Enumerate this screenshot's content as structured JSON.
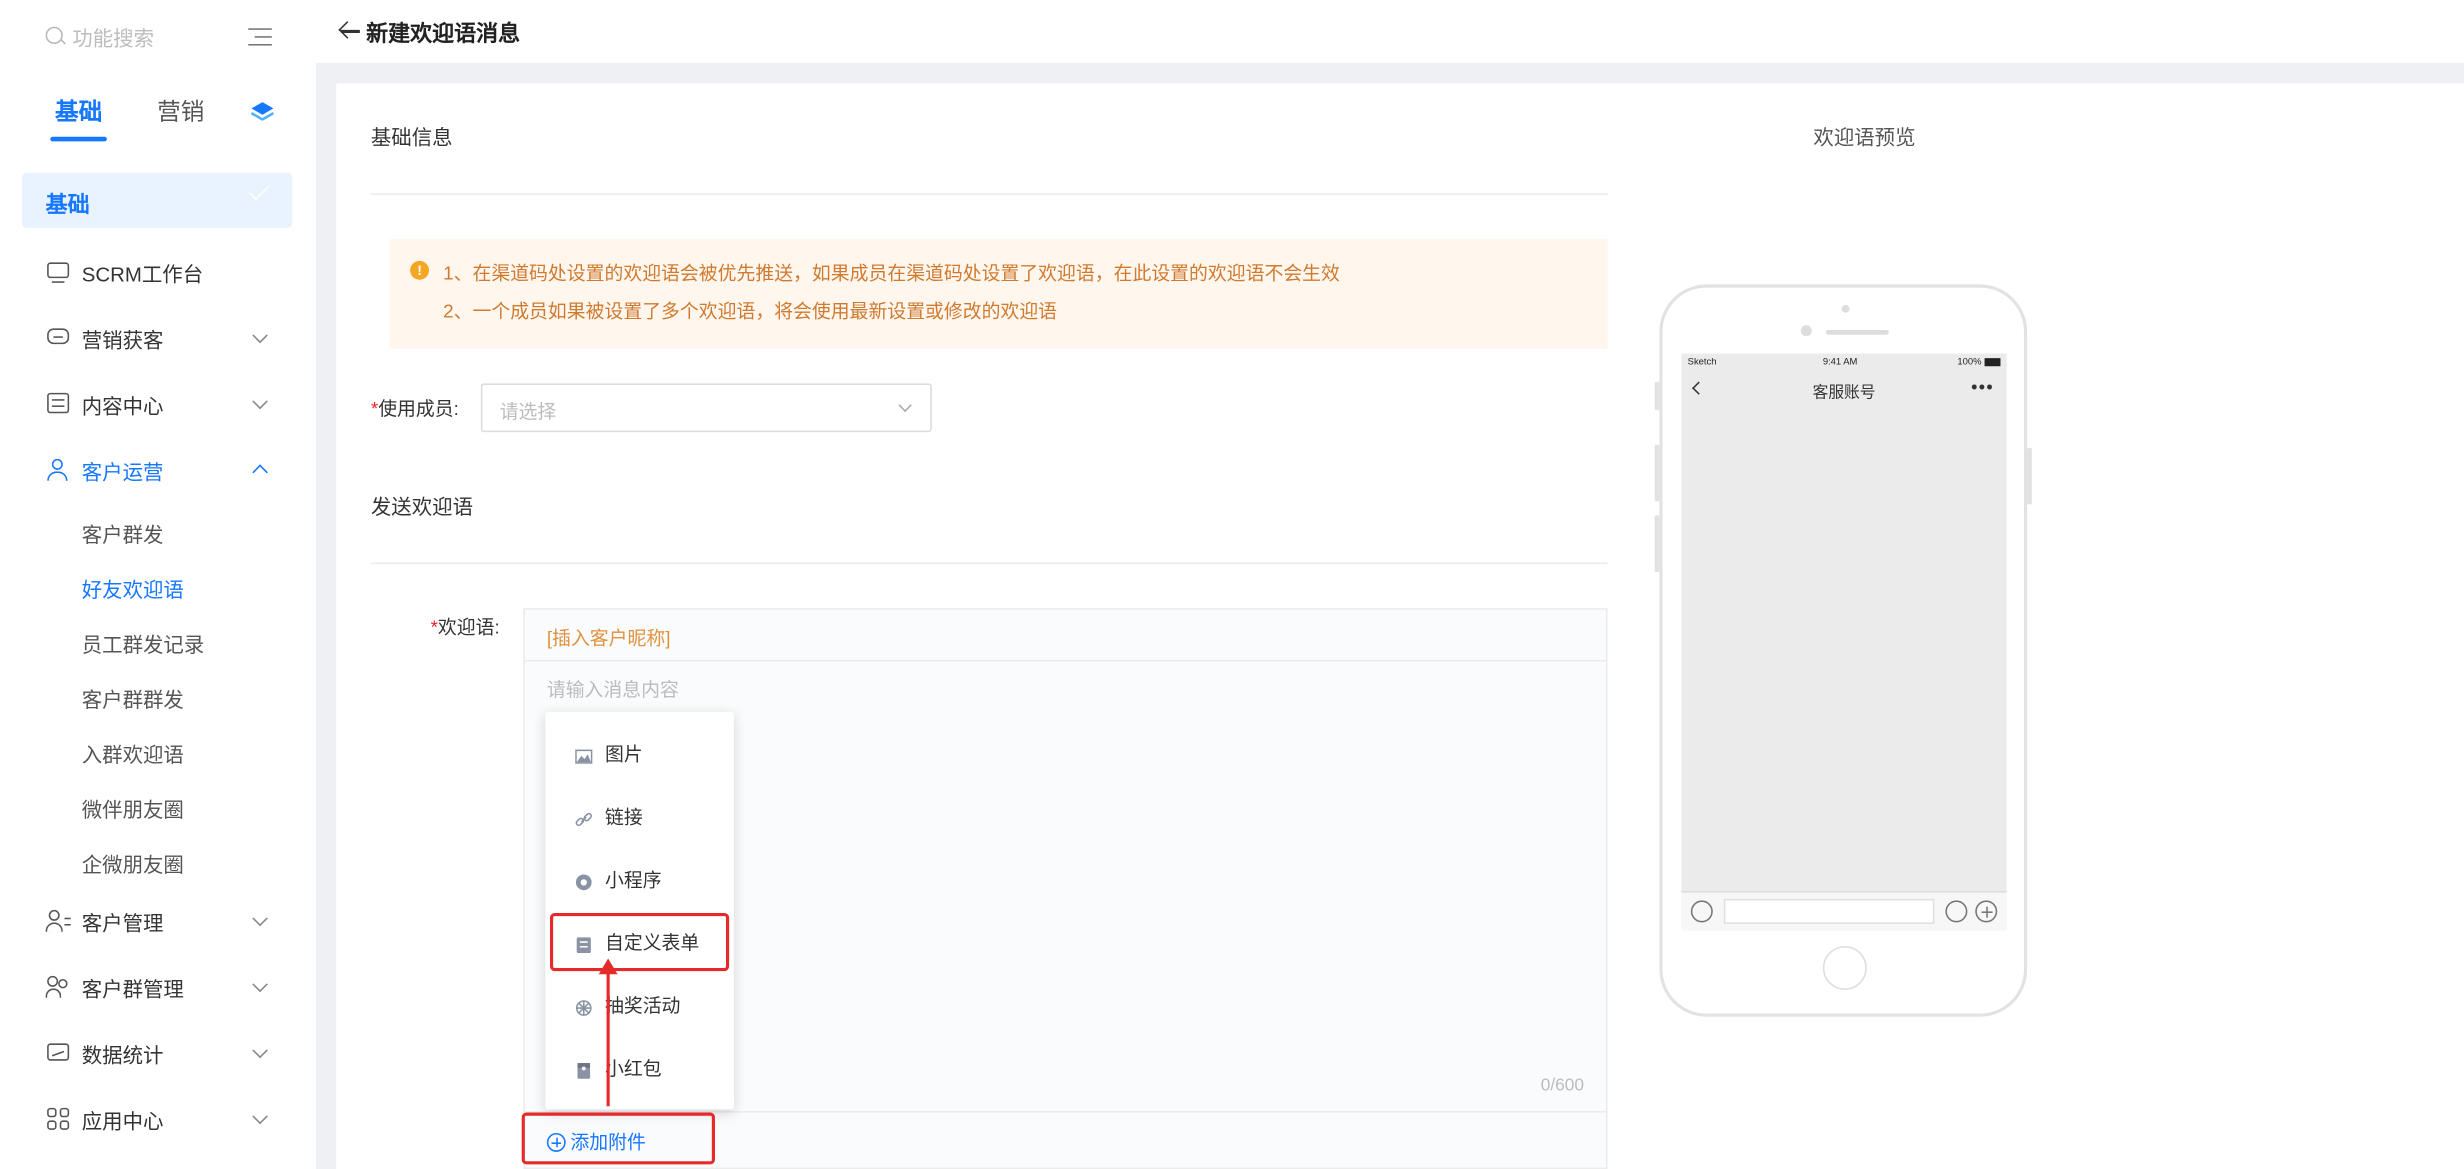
{
  "sidebar": {
    "search_placeholder": "功能搜索",
    "tabs": [
      {
        "label": "基础",
        "active": true
      },
      {
        "label": "营销",
        "active": false
      }
    ],
    "section_label": "基础",
    "items": [
      {
        "label": "SCRM工作台",
        "icon": "workbench-icon"
      },
      {
        "label": "营销获客",
        "icon": "marketing-icon"
      },
      {
        "label": "内容中心",
        "icon": "content-icon"
      },
      {
        "label": "客户运营",
        "icon": "customer-ops-icon"
      },
      {
        "label": "客户管理",
        "icon": "customer-manage-icon"
      },
      {
        "label": "客户群管理",
        "icon": "group-manage-icon"
      },
      {
        "label": "数据统计",
        "icon": "statistics-icon"
      },
      {
        "label": "应用中心",
        "icon": "app-center-icon"
      }
    ],
    "sub_items": [
      "客户群发",
      "好友欢迎语",
      "员工群发记录",
      "客户群群发",
      "入群欢迎语",
      "微伴朋友圈",
      "企微朋友圈"
    ],
    "active_sub": "好友欢迎语",
    "accent": "#1677ff"
  },
  "header": {
    "title": "新建欢迎语消息"
  },
  "form": {
    "basic_title": "基础信息",
    "notice_line1": "1、在渠道码处设置的欢迎语会被优先推送，如果成员在渠道码处设置了欢迎语，在此设置的欢迎语不会生效",
    "notice_line2": "2、一个成员如果被设置了多个欢迎语，将会使用最新设置或修改的欢迎语",
    "member_label": "使用成员:",
    "member_placeholder": "请选择",
    "send_title": "发送欢迎语",
    "welcome_label": "欢迎语:",
    "insert_nickname": "[插入客户昵称]",
    "message_placeholder": "请输入消息内容",
    "counter": "0/600",
    "add_attachment": "添加附件",
    "attachment_menu": [
      {
        "label": "图片",
        "icon": "image-icon"
      },
      {
        "label": "链接",
        "icon": "link-icon"
      },
      {
        "label": "小程序",
        "icon": "mini-program-icon"
      },
      {
        "label": "自定义表单",
        "icon": "form-icon"
      },
      {
        "label": "抽奖活动",
        "icon": "lottery-icon"
      },
      {
        "label": "小红包",
        "icon": "red-packet-icon"
      }
    ],
    "required_mark": "*"
  },
  "preview": {
    "title": "欢迎语预览",
    "status_carrier": "Sketch",
    "status_time": "9:41 AM",
    "status_battery": "100%",
    "chat_title": "客服账号",
    "more": "•••"
  }
}
